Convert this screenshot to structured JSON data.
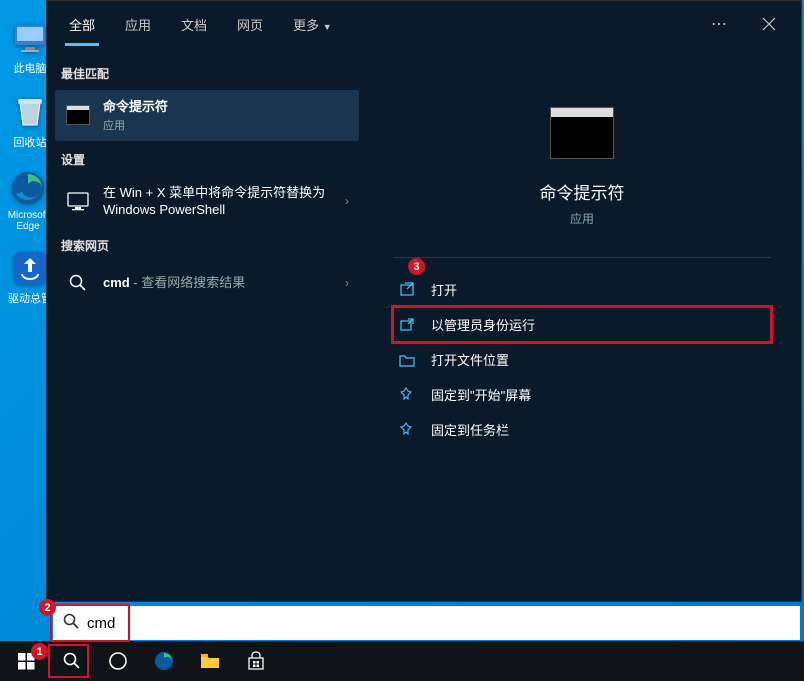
{
  "desktop": {
    "icons": [
      {
        "label": "此电脑"
      },
      {
        "label": "回收站"
      },
      {
        "label": "Microsoft Edge"
      },
      {
        "label": "驱动总管"
      }
    ]
  },
  "search": {
    "tabs": [
      "全部",
      "应用",
      "文档",
      "网页",
      "更多"
    ],
    "sections": {
      "best_match": "最佳匹配",
      "settings": "设置",
      "web": "搜索网页"
    },
    "results": {
      "app": {
        "title": "命令提示符",
        "subtitle": "应用"
      },
      "setting": {
        "title": "在 Win + X 菜单中将命令提示符替换为 Windows PowerShell"
      },
      "web": {
        "query": "cmd",
        "suffix": " - 查看网络搜索结果"
      }
    },
    "preview": {
      "title": "命令提示符",
      "subtitle": "应用",
      "actions": [
        "打开",
        "以管理员身份运行",
        "打开文件位置",
        "固定到\"开始\"屏幕",
        "固定到任务栏"
      ]
    },
    "input": {
      "value": "cmd"
    }
  },
  "annotations": {
    "badge1": "1",
    "badge2": "2",
    "badge3": "3"
  }
}
